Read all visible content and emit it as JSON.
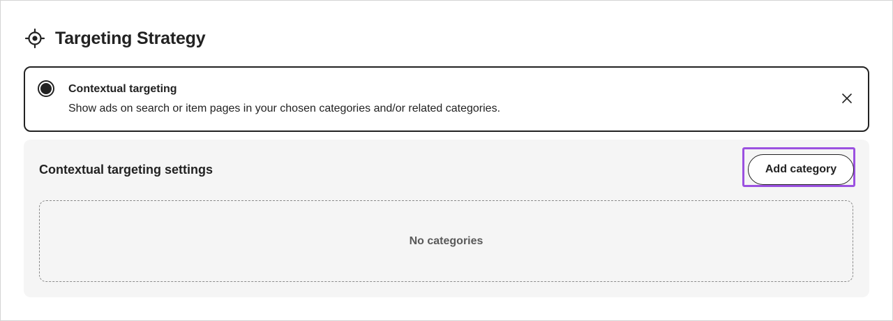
{
  "header": {
    "icon": "target-icon",
    "title": "Targeting Strategy"
  },
  "option": {
    "selected": true,
    "title": "Contextual targeting",
    "description": "Show ads on search or item pages in your chosen categories and/or related categories.",
    "close_icon": "close-icon"
  },
  "settings": {
    "title": "Contextual targeting settings",
    "add_button_label": "Add category",
    "empty_text": "No categories"
  },
  "colors": {
    "highlight": "#9b51e0",
    "panel_background": "#f5f5f5",
    "text": "#222222"
  }
}
